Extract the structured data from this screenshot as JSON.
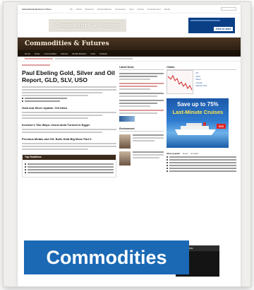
{
  "topbar": {
    "brand": "International Business Times",
    "links": [
      "US",
      "World",
      "Business",
      "Global Markets",
      "Companies",
      "Tech",
      "Culture",
      "Entertainment",
      "Media"
    ]
  },
  "banner": {
    "logo_text": "Commodities & Futures",
    "ad_button": "Click to start"
  },
  "section": {
    "title": "Commodities & Futures",
    "nav": [
      "Home",
      "News",
      "Commodities",
      "Futures",
      "Global Markets",
      "Gold",
      "Analysis"
    ]
  },
  "main": {
    "headline": "Paul Ebeling Gold, Silver and Oil Report, GLD, SLV, USO",
    "subhead_1": "Gold and Silver Update: Citi hikes",
    "subhead_2": "Investor's Two Ways: Invest amid Turmoil in Egypt",
    "subhead_3": "Precious Metals and Oil: Bulls Hold Big Move Part II",
    "headlines_box": "Top Headlines"
  },
  "mid": {
    "latest_news": "Latest News",
    "environment": "Environment"
  },
  "right": {
    "charts": "Charts",
    "chart_links": [
      "Oil",
      "Gold",
      "Silver",
      "Copper",
      "Natural Gas"
    ],
    "cruise_line1": "Save up to 75%",
    "cruise_line2": "Last-Minute Cruises",
    "cruise_button": "GO!",
    "most_popular": "Most popular",
    "most_tabs": [
      "Read",
      "Emailed"
    ],
    "market_videos": "Market Videos"
  },
  "category_label": "Commodities",
  "colors": {
    "label_bg": "#1b69b5",
    "section_bar": "#3a2a1a",
    "cruise_bg": "#2d7bd0"
  }
}
